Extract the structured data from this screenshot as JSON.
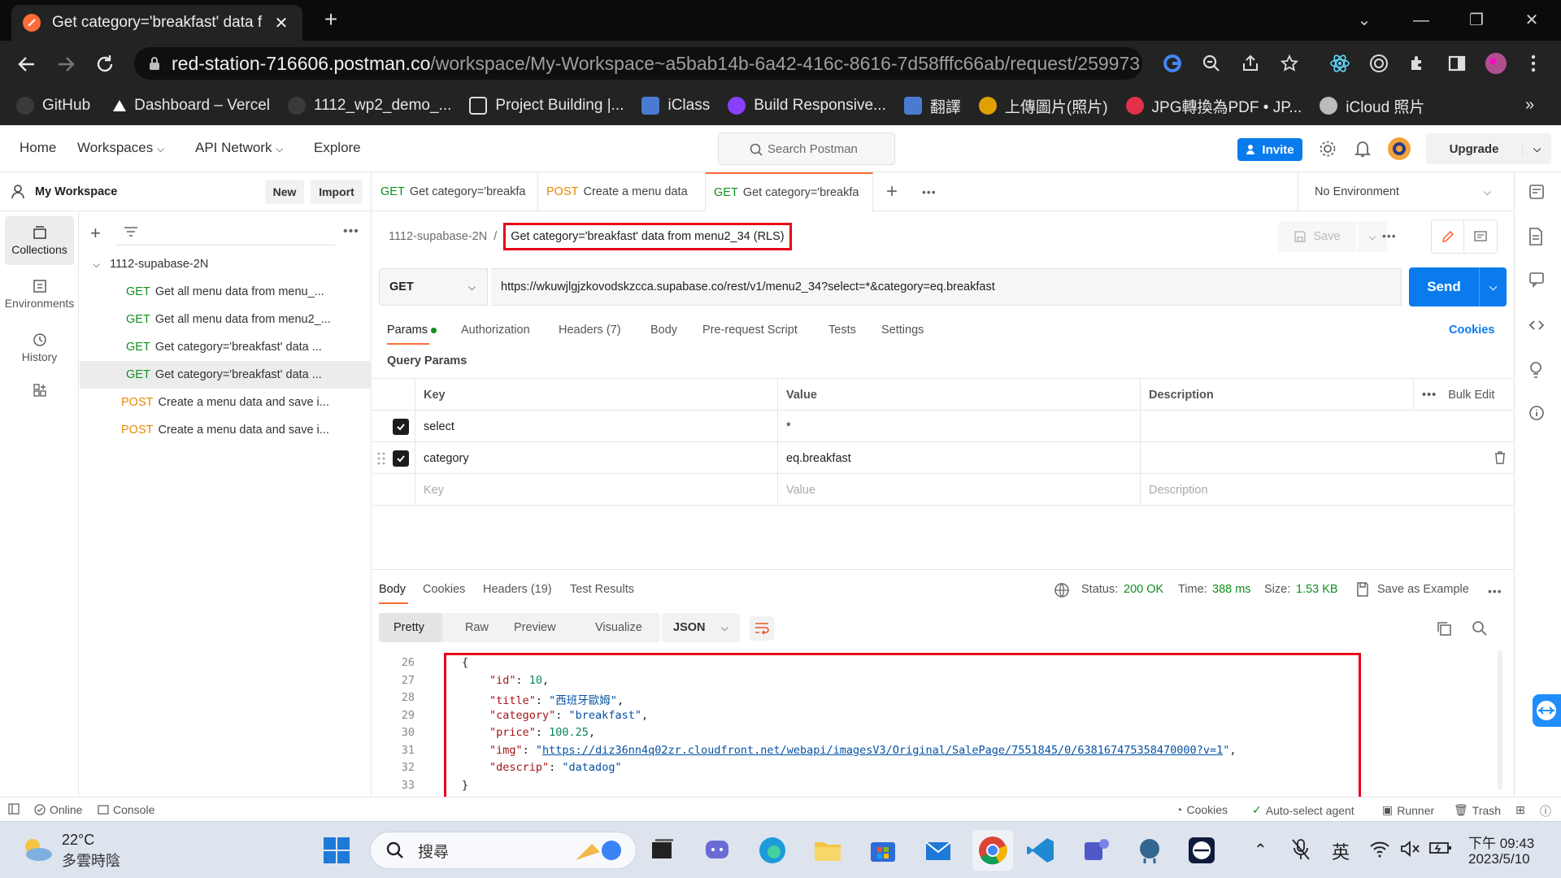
{
  "browser": {
    "tab_title": "Get category='breakfast' data f",
    "url_host": "red-station-716606.postman.co",
    "url_path": "/workspace/My-Workspace~a5bab14b-6a42-416c-8616-7d58fffc66ab/request/259973...",
    "bookmarks": [
      {
        "label": "GitHub",
        "color": "#3a3a3a"
      },
      {
        "label": "Dashboard – Vercel",
        "color": "#ffffff"
      },
      {
        "label": "1112_wp2_demo_...",
        "color": "#3a3a3a"
      },
      {
        "label": "Project Building |...",
        "color": "#e8e8e8"
      },
      {
        "label": "iClass",
        "color": "#4a7bd0"
      },
      {
        "label": "Build Responsive...",
        "color": "#8a3ffc"
      },
      {
        "label": "翻譯",
        "color": "#4a7bd0"
      },
      {
        "label": "上傳圖片(照片)",
        "color": "#e0a000"
      },
      {
        "label": "JPG轉換為PDF • JP...",
        "color": "#e2304a"
      },
      {
        "label": "iCloud 照片",
        "color": "#bbbbbb"
      }
    ],
    "more_bookmarks": "»"
  },
  "header": {
    "nav": [
      "Home",
      "Workspaces",
      "API Network",
      "Explore"
    ],
    "search_placeholder": "Search Postman",
    "invite": "Invite",
    "upgrade": "Upgrade"
  },
  "sidebar": {
    "workspace": "My Workspace",
    "new": "New",
    "import": "Import",
    "rail": [
      "Collections",
      "Environments",
      "History"
    ],
    "collection": "1112-supabase-2N",
    "items": [
      {
        "method": "GET",
        "label": "Get all menu data from menu_..."
      },
      {
        "method": "GET",
        "label": "Get all menu data from menu2_..."
      },
      {
        "method": "GET",
        "label": "Get category='breakfast' data ..."
      },
      {
        "method": "GET",
        "label": "Get category='breakfast' data ..."
      },
      {
        "method": "POST",
        "label": "Create a menu data and save i..."
      },
      {
        "method": "POST",
        "label": "Create a menu data and save i..."
      }
    ]
  },
  "tabs": [
    {
      "method": "GET",
      "label": "Get category='breakfa"
    },
    {
      "method": "POST",
      "label": "Create a menu data"
    },
    {
      "method": "GET",
      "label": "Get category='breakfa"
    }
  ],
  "environment": "No Environment",
  "request": {
    "collection": "1112-supabase-2N",
    "sep": "/",
    "title": "Get category='breakfast' data from menu2_34 (RLS)",
    "save": "Save",
    "method": "GET",
    "url": "https://wkuwjlgjzkovodskzcca.supabase.co/rest/v1/menu2_34?select=*&category=eq.breakfast",
    "send": "Send",
    "subtabs": [
      "Params",
      "Authorization",
      "Headers (7)",
      "Body",
      "Pre-request Script",
      "Tests",
      "Settings"
    ],
    "cookies": "Cookies",
    "query_title": "Query Params",
    "columns": [
      "Key",
      "Value",
      "Description"
    ],
    "bulk_edit": "Bulk Edit",
    "params": [
      {
        "key": "select",
        "value": "*"
      },
      {
        "key": "category",
        "value": "eq.breakfast"
      }
    ],
    "placeholders": {
      "key": "Key",
      "value": "Value",
      "description": "Description"
    }
  },
  "response": {
    "tabs": [
      "Body",
      "Cookies",
      "Headers (19)",
      "Test Results"
    ],
    "status_label": "Status:",
    "status": "200 OK",
    "time_label": "Time:",
    "time": "388 ms",
    "size_label": "Size:",
    "size": "1.53 KB",
    "save_example": "Save as Example",
    "views": [
      "Pretty",
      "Raw",
      "Preview",
      "Visualize"
    ],
    "format": "JSON",
    "line_numbers": [
      "26",
      "27",
      "28",
      "29",
      "30",
      "31",
      "32",
      "33"
    ],
    "json": {
      "id": "10",
      "title": "\"西班牙歐姆\"",
      "category": "\"breakfast\"",
      "price": "100.25",
      "img": "https://diz36nn4q02zr.cloudfront.net/webapi/imagesV3/Original/SalePage/7551845/0/638167475358470000?v=1",
      "descrip": "\"datadog\""
    }
  },
  "statusbar": {
    "online": "Online",
    "console": "Console",
    "cookies": "Cookies",
    "agent": "Auto-select agent",
    "runner": "Runner",
    "trash": "Trash"
  },
  "taskbar": {
    "temp": "22°C",
    "weather": "多雲時陰",
    "search": "搜尋",
    "lang": "英",
    "time": "下午 09:43",
    "date": "2023/5/10"
  },
  "colors": {
    "accent": "#ff6c37",
    "brand_blue": "#097bed",
    "highlight": "#e8001c",
    "get": "#0f8f1e",
    "post": "#e58a00"
  }
}
